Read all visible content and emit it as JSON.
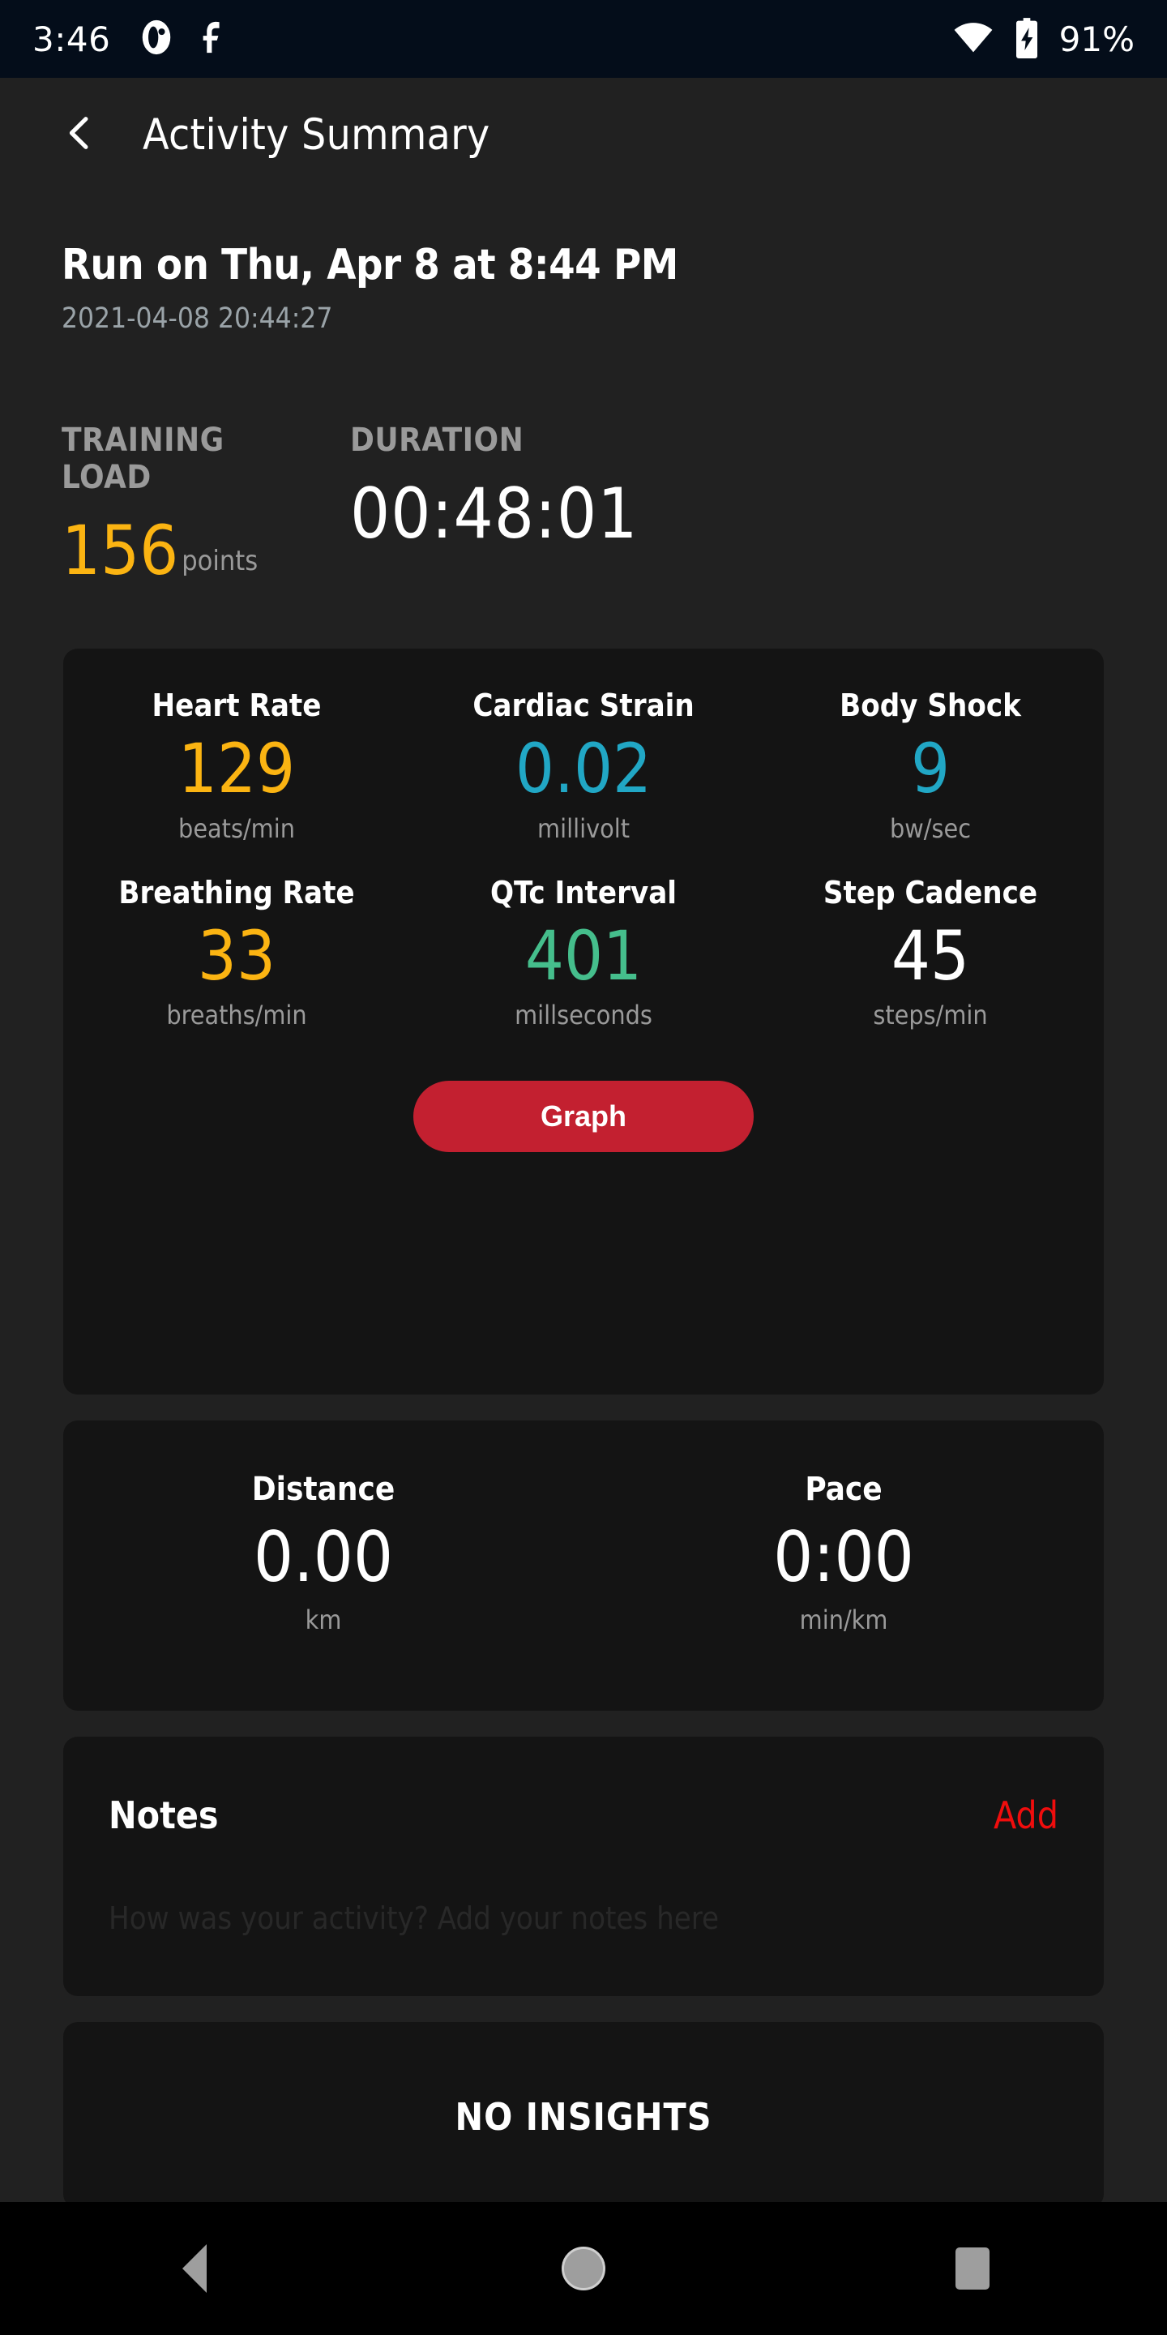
{
  "status_bar": {
    "time": "3:46",
    "left_icons": [
      "moon-phase-icon",
      "fitness-app-icon"
    ],
    "wifi_icon": "wifi-icon",
    "battery_icon": "battery-charging-icon",
    "battery_percent": "91%"
  },
  "app_bar": {
    "back_icon": "chevron-left-icon",
    "title": "Activity Summary"
  },
  "headline": {
    "activity_title": "Run on Thu, Apr 8 at 8:44 PM",
    "timestamp": "2021-04-08 20:44:27"
  },
  "summary": {
    "training_load": {
      "label": "TRAINING LOAD",
      "value": "156",
      "unit": "points",
      "color": "#fbb412"
    },
    "duration": {
      "label": "DURATION",
      "value": "00:48:01",
      "color": "#ffffff"
    }
  },
  "metrics": {
    "row1": [
      {
        "name": "Heart Rate",
        "value": "129",
        "unit": "beats/min",
        "color": "#fbb412"
      },
      {
        "name": "Cardiac Strain",
        "value": "0.02",
        "unit": "millivolt",
        "color": "#21a7c5"
      },
      {
        "name": "Body Shock",
        "value": "9",
        "unit": "bw/sec",
        "color": "#21a7c5"
      }
    ],
    "row2": [
      {
        "name": "Breathing Rate",
        "value": "33",
        "unit": "breaths/min",
        "color": "#fbb412"
      },
      {
        "name": "QTc Interval",
        "value": "401",
        "unit": "millseconds",
        "color": "#45be8c"
      },
      {
        "name": "Step Cadence",
        "value": "45",
        "unit": "steps/min",
        "color": "#ffffff"
      }
    ],
    "graph_button_label": "Graph",
    "graph_button_color": "#c32030"
  },
  "distance_pace": [
    {
      "name": "Distance",
      "value": "0.00",
      "unit": "km"
    },
    {
      "name": "Pace",
      "value": "0:00",
      "unit": "min/km"
    }
  ],
  "notes": {
    "title": "Notes",
    "add_label": "Add",
    "add_color": "#f00d0d",
    "placeholder": "How was your activity? Add your notes here"
  },
  "insights": {
    "empty_label": "NO INSIGHTS"
  },
  "nav_bar": {
    "back_icon": "triangle-back-icon",
    "home_icon": "circle-home-icon",
    "recents_icon": "square-recents-icon"
  }
}
